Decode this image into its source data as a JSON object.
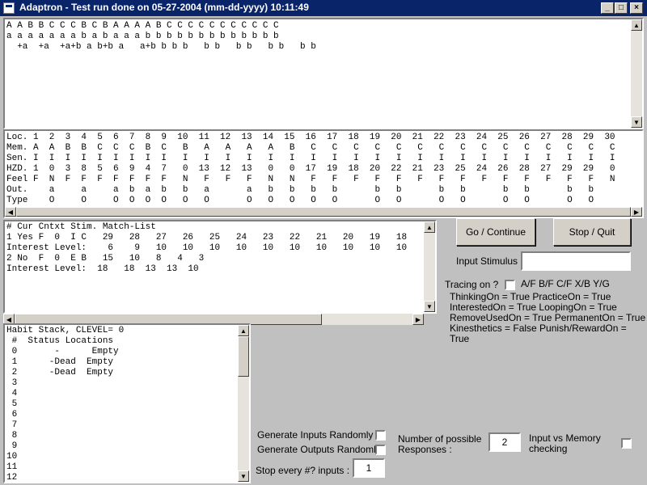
{
  "window": {
    "title": "Adaptron - Test run done on 05-27-2004 (mm-dd-yyyy) 10:11:49",
    "minimize": "_",
    "maximize": "□",
    "close": "×"
  },
  "trace_panel": {
    "lines": [
      "A A B B C C C B C B A A A A B C C C C C C C C C C C",
      "a a a a a a a b a b a a a b b b b b b b b b b b b b",
      "  +a  +a  +a+b a b+b a   a+b b b b   b b   b b   b b   b b"
    ]
  },
  "memory_table": {
    "rows": [
      "Loc. 1  2  3  4  5  6  7  8  9  10  11  12  13  14  15  16  17  18  19  20  21  22  23  24  25  26  27  28  29  30",
      "Mem. A  A  B  B  C  C  C  B  C   B   A   A   A   A   B   C   C   C   C   C   C   C   C   C   C   C   C   C   C   C",
      "Sen. I  I  I  I  I  I  I  I  I   I   I   I   I   I   I   I   I   I   I   I   I   I   I   I   I   I   I   I   I   I",
      "HZD. 1  0  3  8  5  6  9  4  7   0  13  12  13   0   0  17  19  18  20  22  21  23  25  24  26  28  27  29  29   0",
      "Feel F  N  F  F  F  F  F  F  F   N   F   F   F   N   N   F   F   F   F   F   F   F   F   F   F   F   F   F   F   N",
      "Out.    a     a     a  b  a  b   b   a       a   b   b   b   b       b   b       b   b       b   b       b   b",
      "Type    O     O     O  O  O  O   O   O       O   O   O   O   O       O   O       O   O       O   O       O   O"
    ]
  },
  "context_panel": {
    "lines": [
      "# Cur Cntxt Stim. Match-List",
      "1 Yes F  0  I C   29   28   27   26   25   24   23   22   21   20   19   18",
      "Interest Level:    6    9   10   10   10   10   10   10   10   10   10   10",
      "2 No  F  0  E B   15   10   8   4   3",
      "Interest Level:  18   18  13  13  10"
    ]
  },
  "habit_panel": {
    "lines": [
      "Habit Stack, CLEVEL= 0",
      " #  Status Locations",
      " 0       -      Empty",
      " 1      -Dead  Empty",
      " 2      -Dead  Empty",
      " 3",
      " 4",
      " 5",
      " 6",
      " 7",
      " 8",
      " 9",
      "10",
      "11",
      "12"
    ]
  },
  "controls": {
    "go_label": "Go / Continue",
    "stop_label": "Stop / Quit",
    "input_stimulus_label": "Input Stimulus :",
    "input_stimulus_value": "",
    "tracing_label": "Tracing on ?",
    "tracing_options": "A/F  B/F  C/F  X/B  Y/G",
    "status_lines": [
      "ThinkingOn = True PracticeOn = True",
      "InterestedOn = True LoopingOn = True",
      "RemoveUsedOn = True PermanentOn = True",
      "Kinesthetics = False Punish/RewardOn =",
      "True"
    ],
    "gen_inputs_label": "Generate Inputs Randomly ?",
    "gen_outputs_label": "Generate Outputs Randomly?",
    "stop_every_label": "Stop every #? inputs :",
    "stop_every_value": "1",
    "num_responses_label_1": "Number of possible",
    "num_responses_label_2": "Responses :",
    "num_responses_value": "2",
    "input_memory_label_1": "Input vs Memory",
    "input_memory_label_2": "checking"
  },
  "scroll_arrows": {
    "up": "▲",
    "down": "▼",
    "left": "◀",
    "right": "▶"
  }
}
